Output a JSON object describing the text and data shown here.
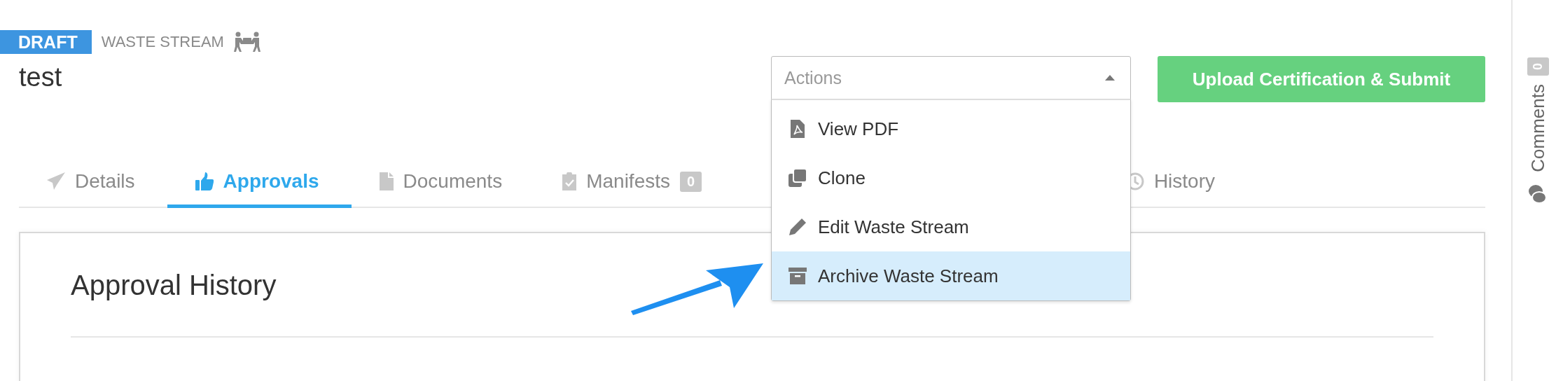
{
  "status_badge": "DRAFT",
  "record_type": "WASTE STREAM",
  "title": "test",
  "actions": {
    "placeholder": "Actions",
    "expanded": true,
    "items": [
      {
        "label": "View PDF",
        "selected": false
      },
      {
        "label": "Clone",
        "selected": false
      },
      {
        "label": "Edit Waste Stream",
        "selected": false
      },
      {
        "label": "Archive Waste Stream",
        "selected": true
      }
    ]
  },
  "submit_button": "Upload Certification & Submit",
  "tabs": [
    {
      "label": "Details",
      "selected": false
    },
    {
      "label": "Approvals",
      "selected": true
    },
    {
      "label": "Documents",
      "selected": false
    },
    {
      "label": "Manifests",
      "selected": false,
      "badge": "0"
    },
    {
      "label": "History",
      "selected": false
    }
  ],
  "card": {
    "title": "Approval History"
  },
  "comments": {
    "label": "Comments",
    "count": "0"
  }
}
